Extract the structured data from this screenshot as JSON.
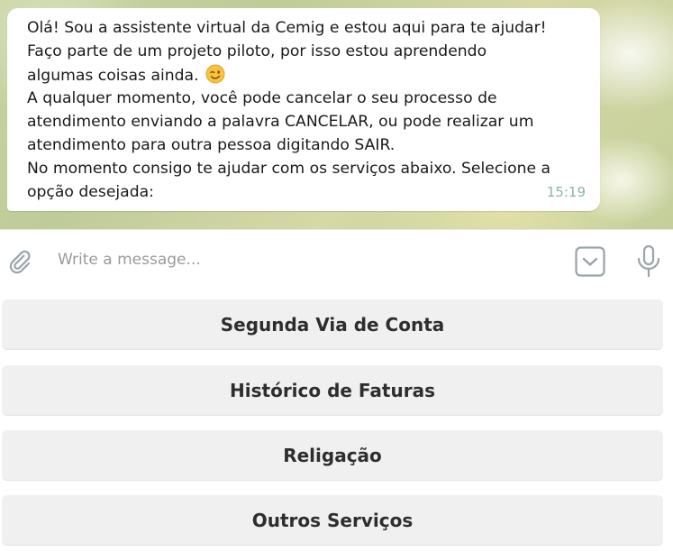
{
  "message": {
    "lines": [
      "Olá! Sou a assistente virtual da Cemig e estou aqui para te ajudar!",
      "Faço parte de um projeto piloto, por isso estou aprendendo",
      "algumas coisas ainda.",
      "A qualquer momento, você pode cancelar o seu processo de",
      "atendimento enviando a palavra CANCELAR, ou pode realizar um",
      "atendimento para outra pessoa digitando SAIR.",
      "No momento consigo te ajudar com os serviços abaixo. Selecione a",
      "opção desejada:"
    ],
    "emoji": "winking-face",
    "time": "15:19"
  },
  "composer": {
    "placeholder": "Write a message...",
    "attach_icon": "paperclip-icon",
    "keyboard_icon": "keyboard-toggle-icon",
    "mic_icon": "microphone-icon"
  },
  "reply_keyboard": {
    "buttons": [
      "Segunda Via de Conta",
      "Histórico de Faturas",
      "Religação",
      "Outros Serviços"
    ]
  },
  "colors": {
    "time": "#8ab3b0",
    "button_bg": "#f0f0f0",
    "icon": "#9aa3a8"
  }
}
